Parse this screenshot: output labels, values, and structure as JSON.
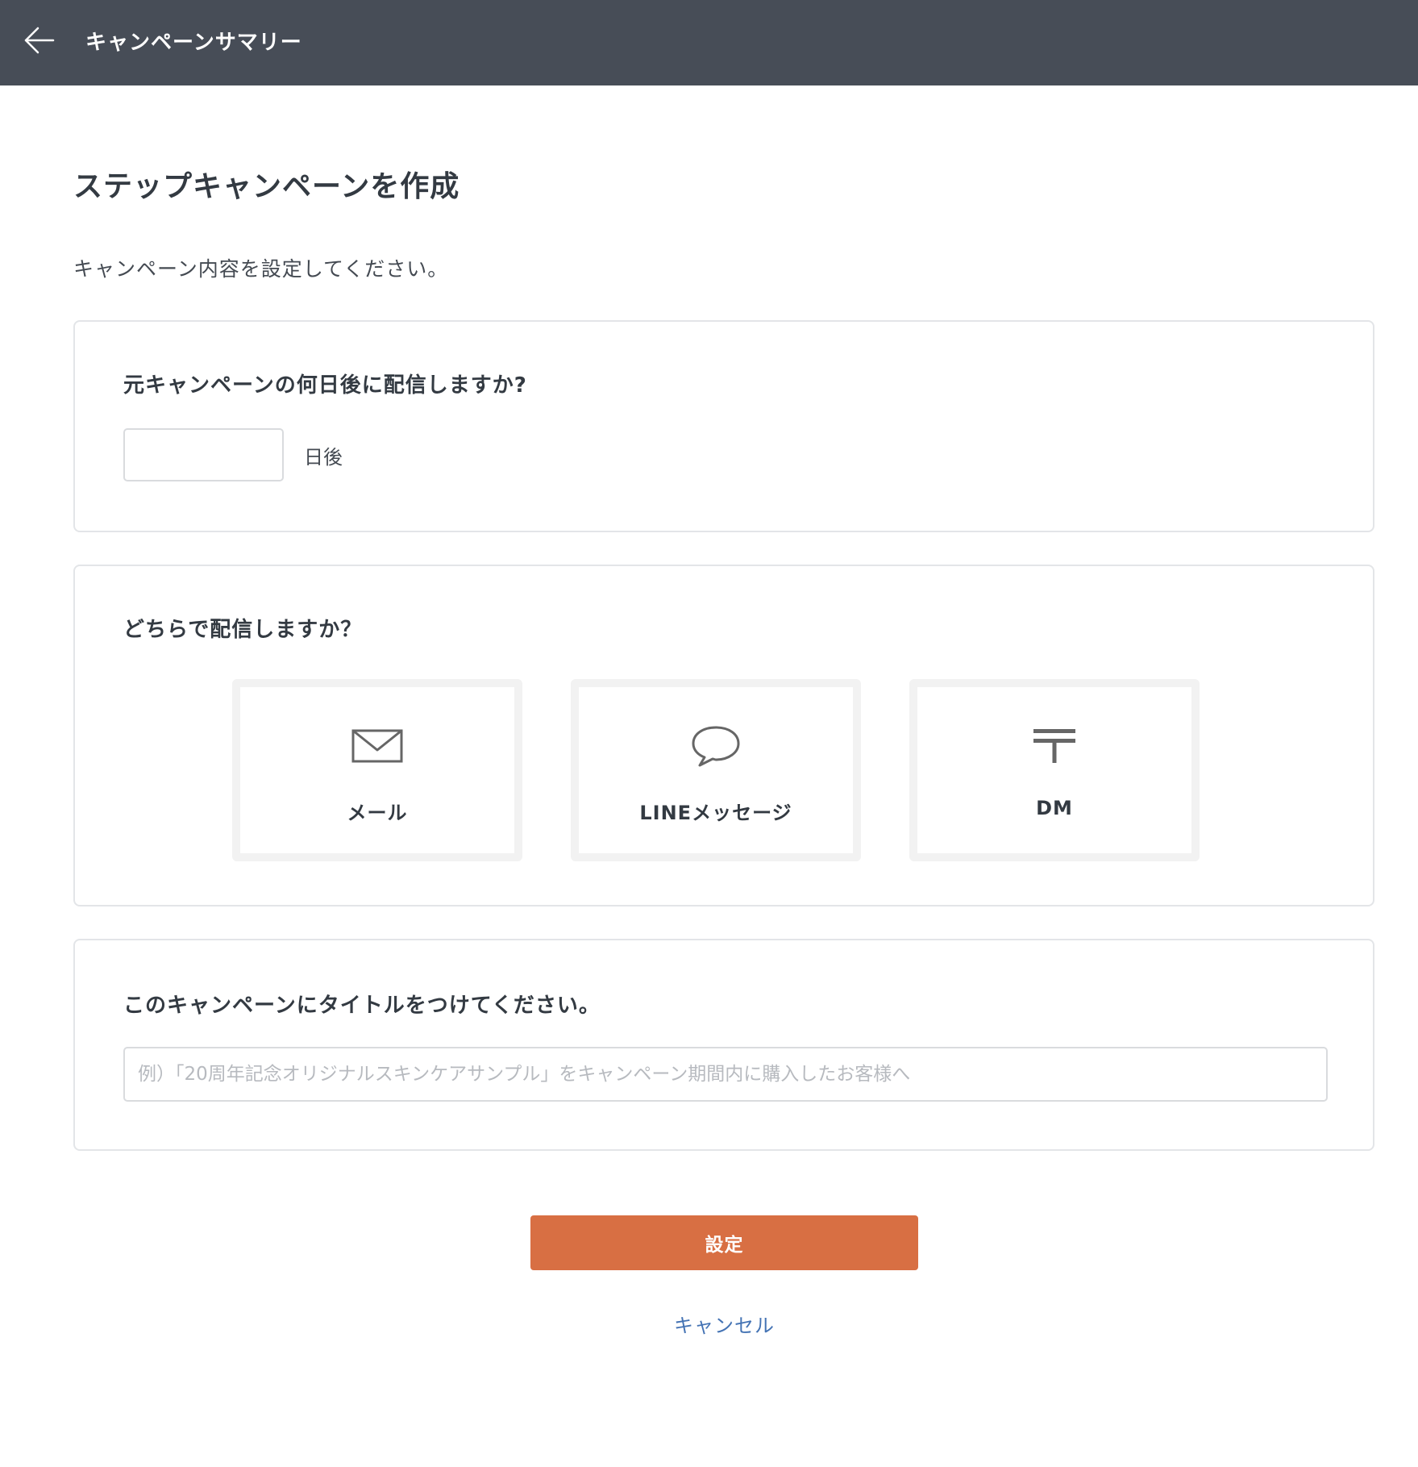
{
  "header": {
    "title": "キャンペーンサマリー",
    "back_icon": "arrow-left-icon"
  },
  "page": {
    "title": "ステップキャンペーンを作成",
    "intro": "キャンペーン内容を設定してください。"
  },
  "delay_section": {
    "heading": "元キャンペーンの何日後に配信しますか?",
    "input_value": "",
    "suffix": "日後"
  },
  "channel_section": {
    "heading": "どちらで配信しますか？",
    "channels": [
      {
        "label": "メール",
        "icon": "mail-icon"
      },
      {
        "label": "LINEメッセージ",
        "icon": "chat-bubble-icon"
      },
      {
        "label": "DM",
        "icon": "postal-mark-icon"
      }
    ]
  },
  "title_section": {
    "heading": "このキャンペーンにタイトルをつけてください。",
    "input_value": "",
    "placeholder": "例）「20周年記念オリジナルスキンケアサンプル」をキャンペーン期間内に購入したお客様へ"
  },
  "actions": {
    "submit_label": "設定",
    "cancel_label": "キャンセル"
  },
  "colors": {
    "header_bg": "#474d57",
    "primary": "#d86f43",
    "link": "#4473b4"
  }
}
